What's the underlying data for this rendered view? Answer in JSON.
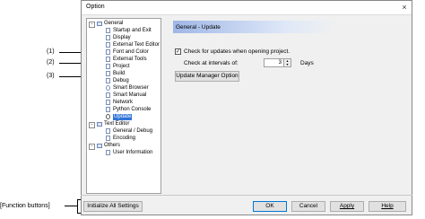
{
  "dialog": {
    "title": "Option",
    "close": "×"
  },
  "tree": {
    "items": [
      {
        "label": "General",
        "expander": "−"
      },
      {
        "label": "Startup and Exit"
      },
      {
        "label": "Display"
      },
      {
        "label": "External Text Editor"
      },
      {
        "label": "Font and Color"
      },
      {
        "label": "External Tools"
      },
      {
        "label": "Project"
      },
      {
        "label": "Build"
      },
      {
        "label": "Debug"
      },
      {
        "label": "Smart Browser"
      },
      {
        "label": "Smart Manual"
      },
      {
        "label": "Network"
      },
      {
        "label": "Python Console"
      },
      {
        "label": "Update"
      },
      {
        "label": "Text Editor",
        "expander": "−"
      },
      {
        "label": "General / Debug"
      },
      {
        "label": "Encoding"
      },
      {
        "label": "Others",
        "expander": "−"
      },
      {
        "label": "User Information"
      }
    ]
  },
  "panel": {
    "header": "General - Update",
    "check_updates_label": "Check for updates when opening project.",
    "check_updates_checked": true,
    "check_mark": "✓",
    "interval_label": "Check at intervals of:",
    "interval_value": "3",
    "interval_unit": "Days",
    "spin_up": "▲",
    "spin_down": "▼",
    "update_manager_button": "Update Manager Option"
  },
  "footer": {
    "initialize": "Initialize All Settings",
    "ok": "OK",
    "cancel": "Cancel",
    "apply": "Apply",
    "help": "Help"
  },
  "callouts": {
    "c1": "(1)",
    "c2": "(2)",
    "c3": "(3)",
    "function_buttons": "[Function buttons]"
  }
}
